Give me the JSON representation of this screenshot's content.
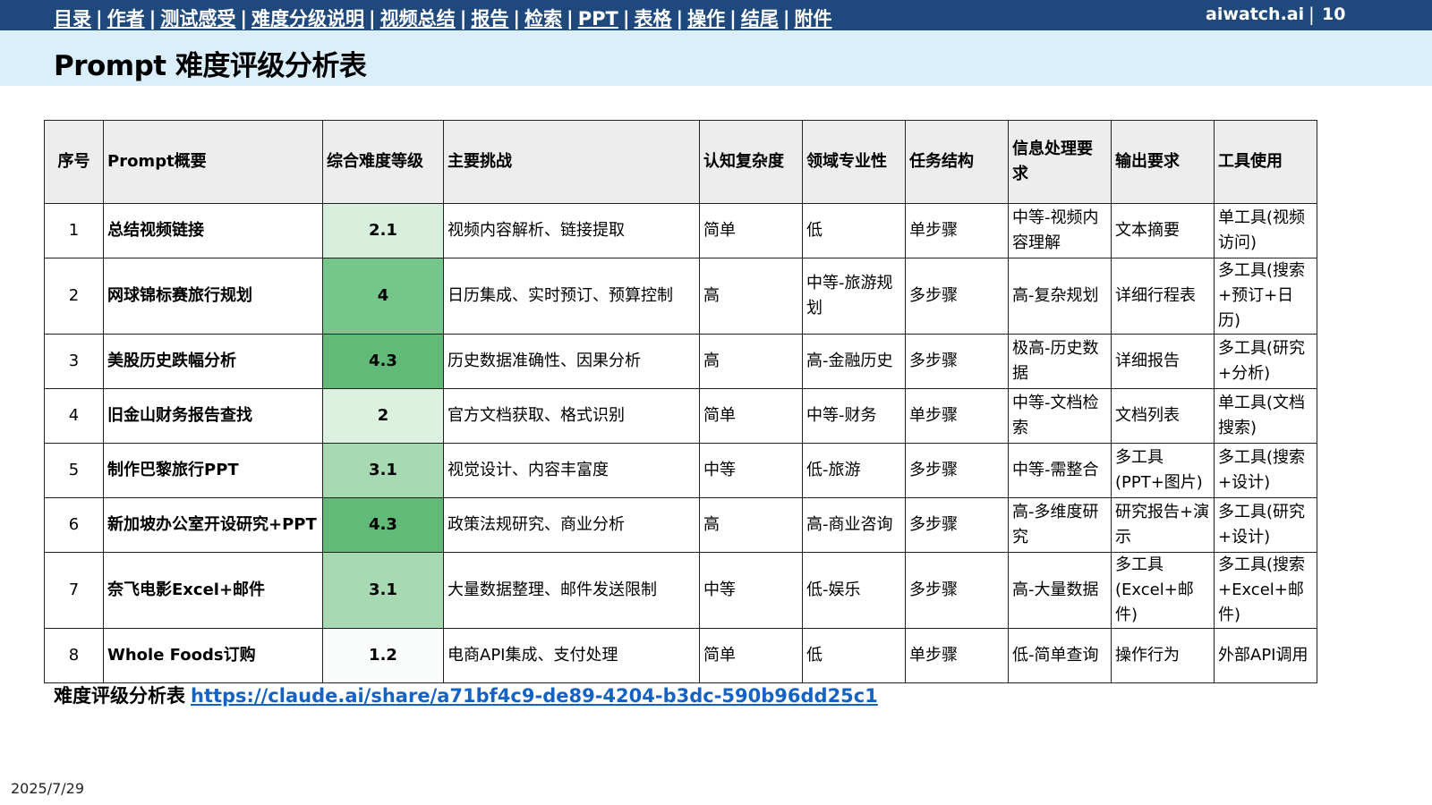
{
  "nav": {
    "items": [
      "目录",
      "作者",
      "测试感受",
      "难度分级说明",
      "视频总结",
      "报告",
      "检索",
      "PPT",
      "表格",
      "操作",
      "结尾",
      "附件"
    ],
    "separator": "|",
    "brand": "aiwatch.ai",
    "brand_separator": "|",
    "page_number": "10"
  },
  "title": "Prompt 难度评级分析表",
  "colors": {
    "topbar": "#1f497d",
    "titlebar": "#dbeefc",
    "link": "#1463c4"
  },
  "table": {
    "headers": [
      "序号",
      "Prompt概要",
      "综合难度等级",
      "主要挑战",
      "认知复杂度",
      "领域专业性",
      "任务结构",
      "信息处理要求",
      "输出要求",
      "工具使用"
    ],
    "rows": [
      {
        "cells": [
          "1",
          "总结视频链接",
          "2.1",
          "视频内容解析、链接提取",
          "简单",
          "低",
          "单步骤",
          "中等-视频内容理解",
          "文本摘要",
          "单工具(视频访问)"
        ],
        "level_color": "#d7efdc"
      },
      {
        "cells": [
          "2",
          "网球锦标赛旅行规划",
          "4",
          "日历集成、实时预订、预算控制",
          "高",
          "中等-旅游规划",
          "多步骤",
          "高-复杂规划",
          "详细行程表",
          "多工具(搜索+预订+日历)"
        ],
        "level_color": "#75c68a"
      },
      {
        "cells": [
          "3",
          "美股历史跌幅分析",
          "4.3",
          "历史数据准确性、因果分析",
          "高",
          "高-金融历史",
          "多步骤",
          "极高-历史数据",
          "详细报告",
          "多工具(研究+分析)"
        ],
        "level_color": "#62ba78"
      },
      {
        "cells": [
          "4",
          "旧金山财务报告查找",
          "2",
          "官方文档获取、格式识别",
          "简单",
          "中等-财务",
          "单步骤",
          "中等-文档检索",
          "文档列表",
          "单工具(文档搜索)"
        ],
        "level_color": "#dcf1e0"
      },
      {
        "cells": [
          "5",
          "制作巴黎旅行PPT",
          "3.1",
          "视觉设计、内容丰富度",
          "中等",
          "低-旅游",
          "多步骤",
          "中等-需整合",
          "多工具(PPT+图片)",
          "多工具(搜索+设计)"
        ],
        "level_color": "#a7d9b2"
      },
      {
        "cells": [
          "6",
          "新加坡办公室开设研究+PPT",
          "4.3",
          "政策法规研究、商业分析",
          "高",
          "高-商业咨询",
          "多步骤",
          "高-多维度研究",
          "研究报告+演示",
          "多工具(研究+设计)"
        ],
        "level_color": "#62ba78"
      },
      {
        "cells": [
          "7",
          "奈飞电影Excel+邮件",
          "3.1",
          "大量数据整理、邮件发送限制",
          "中等",
          "低-娱乐",
          "多步骤",
          "高-大量数据",
          "多工具(Excel+邮件)",
          "多工具(搜索+Excel+邮件)"
        ],
        "level_color": "#a7d9b2"
      },
      {
        "cells": [
          "8",
          "Whole Foods订购",
          "1.2",
          "电商API集成、支付处理",
          "简单",
          "低",
          "单步骤",
          "低-简单查询",
          "操作行为",
          "外部API调用"
        ],
        "level_color": "#f9fcfa"
      }
    ]
  },
  "footer": {
    "label": "难度评级分析表",
    "link_text": "https://claude.ai/share/a71bf4c9-de89-4204-b3dc-590b96dd25c1"
  },
  "date": "2025/7/29"
}
